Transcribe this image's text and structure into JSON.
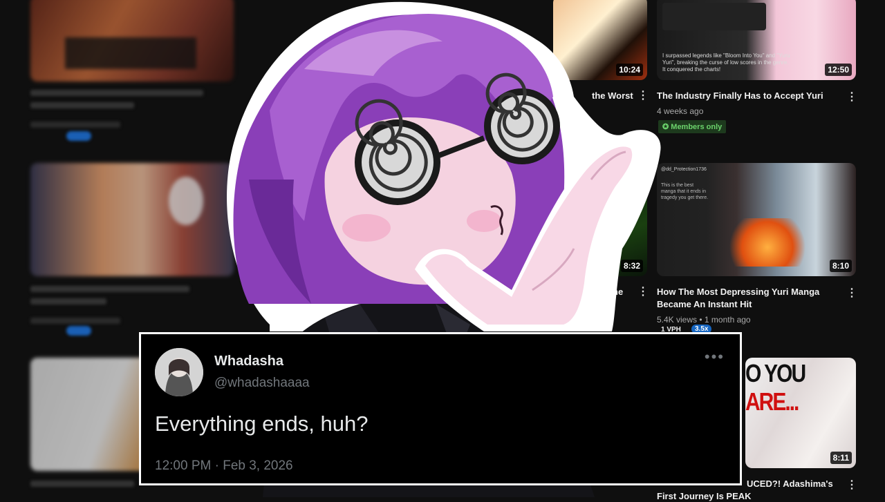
{
  "videos": [
    {
      "title": "The Industry Finally Has to Accept Yuri",
      "meta": "4 weeks ago",
      "badge": "Members only",
      "duration": "12:50",
      "menu": "⋮",
      "comment": "I surpassed legends like \"Bloom Into You\" and \"Yuru Yuri\", breaking the curse of low scores in the genre. It conquered the charts!"
    },
    {
      "title": "How The Most Depressing Yuri Manga",
      "title2": "Became An Instant Hit",
      "meta": "5.4K views • 1 month ago",
      "duration": "8:10",
      "menu": "⋮",
      "comment_user": "@dd_Protection1736",
      "comment": "This is the best manga that it ends in tragedy you get there.",
      "pill1": "1 VPH",
      "pill2": "3.5x"
    },
    {
      "title_visible": "UCED?! Adashima's",
      "title2": "First Journey Is PEAK",
      "thumb_text_1": "O YOU ",
      "thumb_text_2": "ARE...",
      "duration": "8:11",
      "menu": "⋮"
    },
    {
      "title_partial": "the Worst",
      "duration": "10:24",
      "menu": "⋮"
    },
    {
      "title_partial": "he",
      "duration": "8:32",
      "menu": "⋮"
    }
  ],
  "tweet": {
    "name": "Whadasha",
    "handle": "@whadashaaaa",
    "text": "Everything ends, huh?",
    "timestamp": "12:00 PM · Feb 3, 2026",
    "more": "•••"
  }
}
